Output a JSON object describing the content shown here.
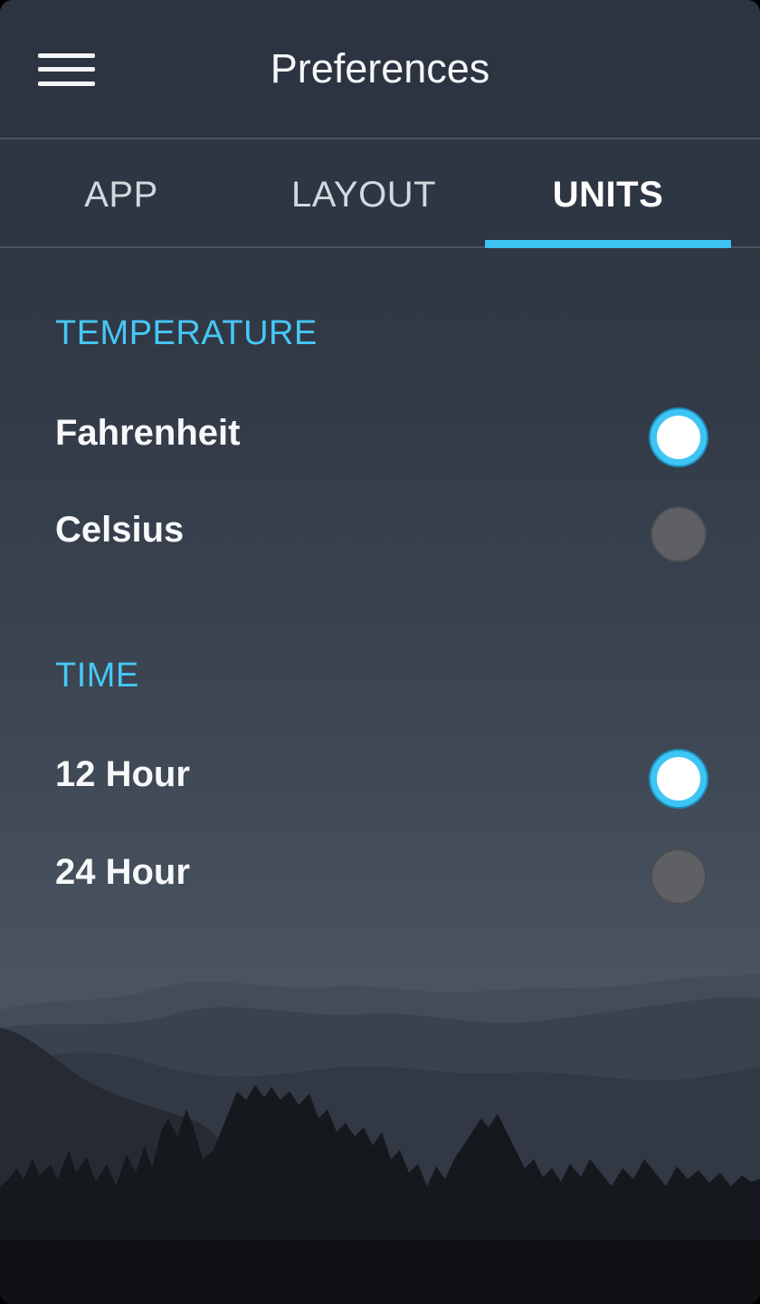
{
  "header": {
    "title": "Preferences",
    "menu_icon": "hamburger-menu-icon"
  },
  "tabs": [
    {
      "label": "APP",
      "active": false
    },
    {
      "label": "LAYOUT",
      "active": false
    },
    {
      "label": "UNITS",
      "active": true
    }
  ],
  "sections": [
    {
      "title": "TEMPERATURE",
      "options": [
        {
          "label": "Fahrenheit",
          "selected": true
        },
        {
          "label": "Celsius",
          "selected": false
        }
      ]
    },
    {
      "title": "TIME",
      "options": [
        {
          "label": "12 Hour",
          "selected": true
        },
        {
          "label": "24 Hour",
          "selected": false
        }
      ]
    }
  ],
  "colors": {
    "accent": "#3ec5f4",
    "header_bg": "#2c3441",
    "text": "#f7f8fa",
    "radio_unselected": "#5f6063"
  }
}
